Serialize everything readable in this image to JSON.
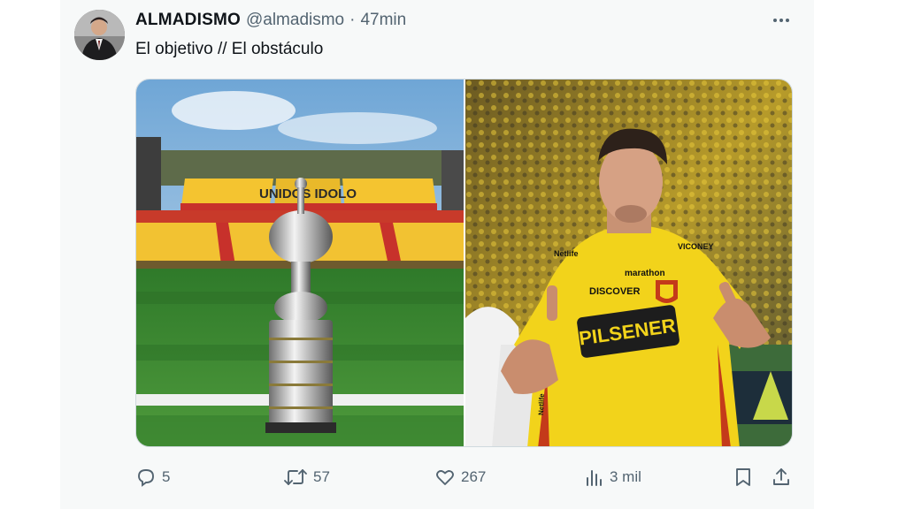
{
  "tweet": {
    "display_name": "ALMADISMO",
    "handle": "@almadismo",
    "separator": "·",
    "time": "47min",
    "text": "El objetivo // El obstáculo",
    "more_icon": "more-horizontal-icon"
  },
  "media": {
    "left_stadium_sign": "UNIDOS IDOLO",
    "right_shirt_sponsor": "PILSENER",
    "right_shirt_front": "DISCOVER",
    "right_shirt_top": "marathon",
    "right_shirt_shoulder": "Netlife",
    "right_shirt_sleeve_right": "VICONEY",
    "right_shirt_side": "Netlife"
  },
  "actions": {
    "reply_count": "5",
    "retweet_count": "57",
    "like_count": "267",
    "views_count": "3 mil",
    "icons": [
      "reply-icon",
      "retweet-icon",
      "like-icon",
      "views-icon",
      "bookmark-icon",
      "share-icon"
    ]
  },
  "colors": {
    "text_primary": "#0f1419",
    "text_secondary": "#536471",
    "card_bg": "#f7f9f9",
    "jersey_yellow": "#f2d31b",
    "grass": "#3f8a33"
  }
}
